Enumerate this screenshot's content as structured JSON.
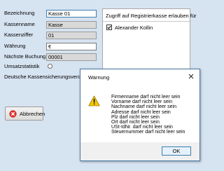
{
  "form": {
    "fields": [
      {
        "label": "Bezeichnung",
        "value": "Kasse 01"
      },
      {
        "label": "Kassenname",
        "value": "Kasse"
      },
      {
        "label": "Kassenziffer",
        "value": "01"
      },
      {
        "label": "Währung",
        "value": "€"
      },
      {
        "label": "Nächste Buchung",
        "value": "00001"
      }
    ],
    "umsatzstatistik_label": "Umsatzstatistik",
    "dsv_label": "Deutsche Kassensicherungsverordnung",
    "cancel_label": "Abbrechen"
  },
  "access": {
    "header": "Zugriff auf Registrierkasse erlauben für",
    "users": [
      {
        "name": "Alexander Kollin",
        "checked": true
      }
    ]
  },
  "dialog": {
    "title": "Warnung",
    "messages": [
      "Firmenname darf nicht leer sein",
      "Vorname darf nicht leer sein",
      "Nachname darf nicht leer sein",
      "Adresse darf nicht leer sein",
      "Plz darf nicht leer sein",
      "Ort darf nicht leer sein",
      "USt-IdNr. darf nicht leer sein",
      "Steuernummer darf nicht leer sein"
    ],
    "ok_label": "OK"
  },
  "icons": [
    "cancel-icon",
    "warning-icon",
    "close-icon",
    "checkmark-icon"
  ],
  "colors": {
    "background": "#d6e3f1",
    "cancel_red": "#d9302c",
    "warning_yellow": "#f6c800",
    "accent": "#3c7fb1"
  }
}
